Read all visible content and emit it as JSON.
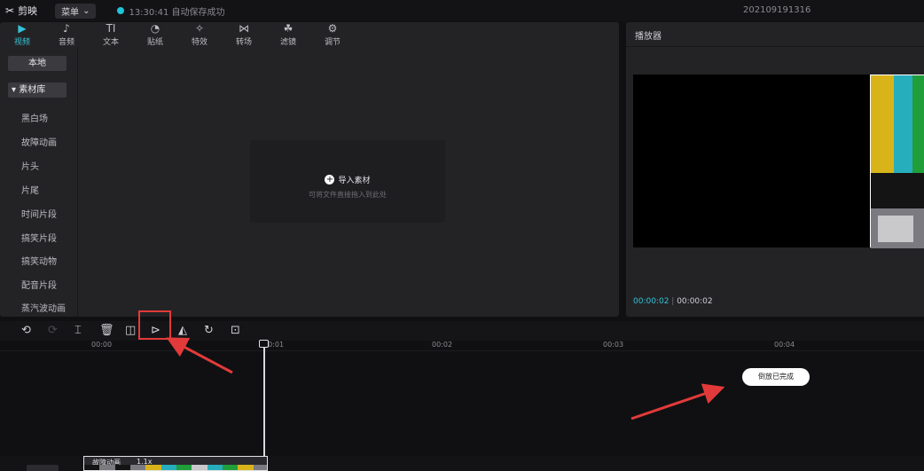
{
  "header": {
    "app_name": "剪映",
    "menu_label": "菜单",
    "save_status": "13:30:41 自动保存成功",
    "project_name": "202109191316"
  },
  "media_tabs": [
    {
      "label": "视频",
      "icon": "▶"
    },
    {
      "label": "音频",
      "icon": "♪"
    },
    {
      "label": "文本",
      "icon": "TI"
    },
    {
      "label": "贴纸",
      "icon": "◔"
    },
    {
      "label": "特效",
      "icon": "✧"
    },
    {
      "label": "转场",
      "icon": "⋈"
    },
    {
      "label": "滤镜",
      "icon": "☘"
    },
    {
      "label": "调节",
      "icon": "⚙"
    }
  ],
  "sidebar": {
    "local_label": "本地",
    "library_label": "素材库",
    "items": [
      "黑白场",
      "故障动画",
      "片头",
      "片尾",
      "时间片段",
      "搞笑片段",
      "搞笑动物",
      "配音片段",
      "蒸汽波动画"
    ]
  },
  "import": {
    "title": "导入素材",
    "hint": "可将文件直接拖入到此处"
  },
  "player": {
    "title": "播放器",
    "current_time": "00:00:02",
    "total_time": "00:00:02",
    "test_pattern_colors": [
      "#d8b41a",
      "#27aebd",
      "#1f9e3a",
      "#1f9e3a",
      "#7a7a80",
      "#c9c9cc",
      "#141414"
    ]
  },
  "timeline": {
    "ruler": [
      "00:00",
      "00:01",
      "00:02",
      "00:03",
      "00:04"
    ],
    "toast": "倒放已完成",
    "clip_label": "故障动画",
    "clip_speed": "1.1x"
  },
  "toolbar": {
    "undo_icon": "⟲",
    "redo_icon": "⟳",
    "split_icon": "⌶",
    "delete_icon": "🗑",
    "freeze_icon": "◫",
    "reverse_icon": "⊳",
    "mirror_icon": "◭",
    "rotate_icon": "↻",
    "crop_icon": "⊡"
  },
  "annotation_color": "#e23a3a"
}
